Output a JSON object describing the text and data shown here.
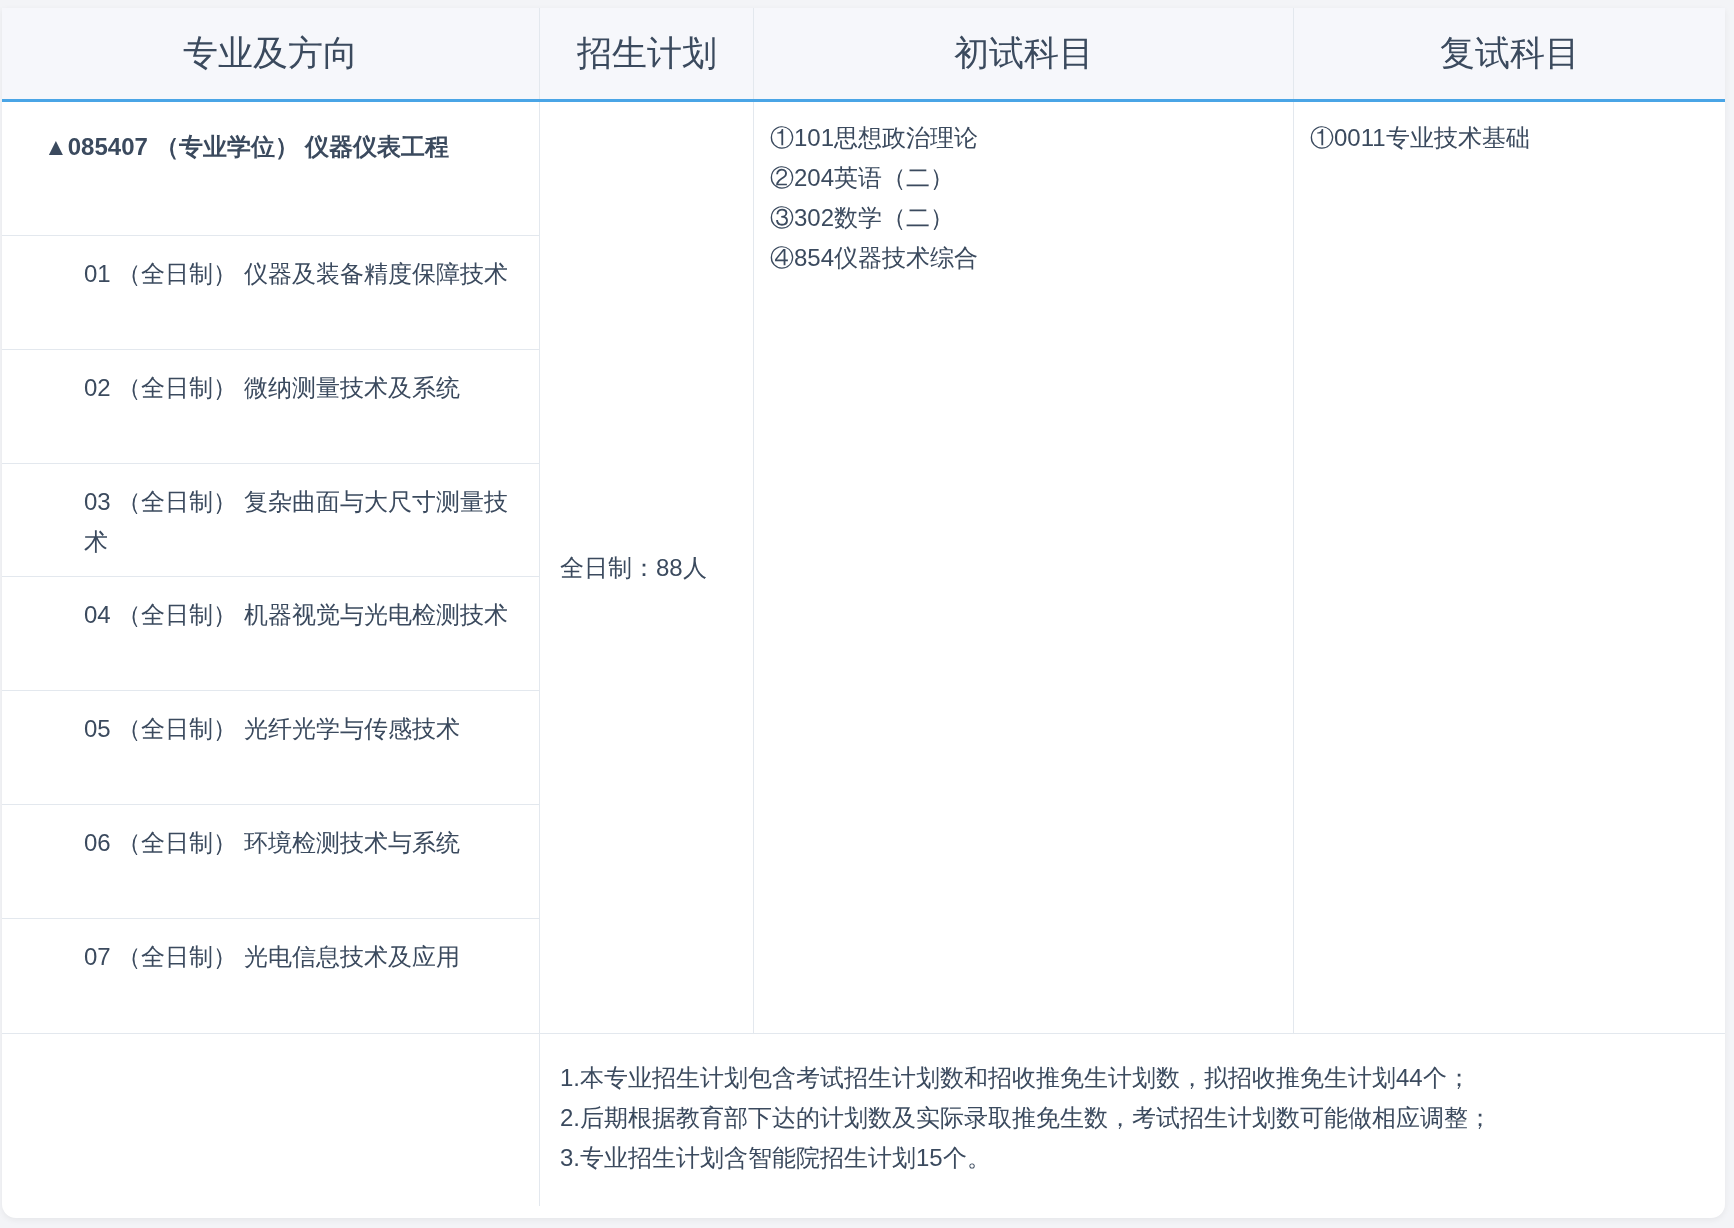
{
  "table": {
    "columns": [
      "专业及方向",
      "招生计划",
      "初试科目",
      "复试科目"
    ],
    "major": {
      "label": "▲085407 （专业学位） 仪器仪表工程",
      "directions": [
        "01 （全日制） 仪器及装备精度保障技术",
        "02 （全日制） 微纳测量技术及系统",
        "03 （全日制） 复杂曲面与大尺寸测量技术",
        "04 （全日制） 机器视觉与光电检测技术",
        "05 （全日制） 光纤光学与传感技术",
        "06 （全日制） 环境检测技术与系统",
        "07 （全日制） 光电信息技术及应用"
      ]
    },
    "plan": "全日制：88人",
    "initial_subjects": [
      "①101思想政治理论",
      "②204英语（二）",
      "③302数学（二）",
      "④854仪器技术综合"
    ],
    "retest_subjects": [
      "①0011专业技术基础"
    ],
    "notes": [
      "1.本专业招生计划包含考试招生计划数和招收推免生计划数，拟招收推免生计划44个；",
      "2.后期根据教育部下达的计划数及实际录取推免生数，考试招生计划数可能做相应调整；",
      "3.专业招生计划含智能院招生计划15个。"
    ]
  }
}
